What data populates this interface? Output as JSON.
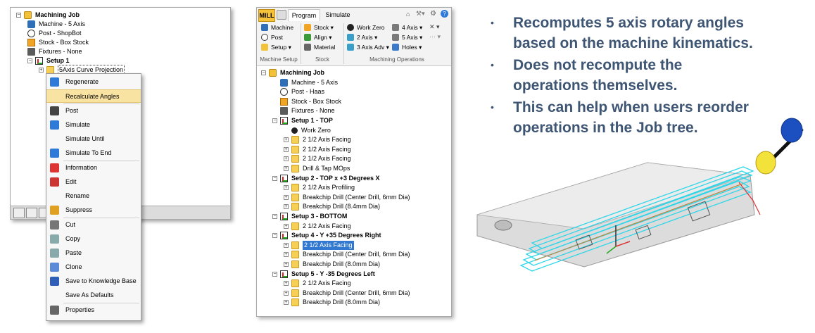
{
  "left_tree": {
    "items": [
      {
        "label": "Machining Job",
        "icon": "job-icon"
      },
      {
        "label": "Machine - 5 Axis",
        "icon": "machine-icon"
      },
      {
        "label": "Post - ShopBot",
        "icon": "post-icon"
      },
      {
        "label": "Stock - Box Stock",
        "icon": "stock-icon"
      },
      {
        "label": "Fixtures - None",
        "icon": "fixture-icon"
      },
      {
        "label": "Setup 1",
        "icon": "setup-icon"
      },
      {
        "label": "5Axis Curve Projection",
        "icon": "folder-icon"
      }
    ]
  },
  "context_menu": {
    "items": [
      {
        "label": "Regenerate",
        "icon": "regenerate-icon"
      },
      {
        "label": "Recalculate Angles",
        "icon": "none",
        "highlighted": true
      },
      {
        "label": "Post",
        "icon": "post-icon"
      },
      {
        "label": "Simulate",
        "icon": "play-icon"
      },
      {
        "label": "Simulate Until",
        "icon": "none"
      },
      {
        "label": "Simulate To End",
        "icon": "fast-forward-icon"
      },
      {
        "label": "Information",
        "icon": "info-icon"
      },
      {
        "label": "Edit",
        "icon": "edit-icon"
      },
      {
        "label": "Rename",
        "icon": "none"
      },
      {
        "label": "Suppress",
        "icon": "suppress-icon"
      },
      {
        "label": "Cut",
        "icon": "scissors-icon"
      },
      {
        "label": "Copy",
        "icon": "copy-icon"
      },
      {
        "label": "Paste",
        "icon": "paste-icon"
      },
      {
        "label": "Clone",
        "icon": "clone-icon"
      },
      {
        "label": "Save to Knowledge Base",
        "icon": "knowledge-base-icon"
      },
      {
        "label": "Save As Defaults",
        "icon": "none"
      },
      {
        "label": "Properties",
        "icon": "properties-icon"
      }
    ]
  },
  "ribbon": {
    "tabs": [
      "MILL",
      "Program",
      "Simulate"
    ],
    "active_tab": "Program",
    "buttons": {
      "machine": "Machine",
      "post": "Post",
      "setup": "Setup",
      "stock": "Stock",
      "align": "Align",
      "material": "Material",
      "work_zero": "Work Zero",
      "two_axis": "2 Axis",
      "three_axis_adv": "3 Axis Adv",
      "four_axis": "4 Axis",
      "five_axis": "5 Axis",
      "holes": "Holes"
    },
    "groups": [
      "Machine Setup",
      "Stock",
      "Machining Operations"
    ]
  },
  "job_tree": {
    "items": [
      {
        "label": "Machining Job",
        "bold": true,
        "level": 0,
        "icon": "job-icon"
      },
      {
        "label": "Machine - 5 Axis",
        "level": 1,
        "icon": "machine-icon"
      },
      {
        "label": "Post - Haas",
        "level": 1,
        "icon": "post-icon"
      },
      {
        "label": "Stock - Box Stock",
        "level": 1,
        "icon": "stock-icon"
      },
      {
        "label": "Fixtures - None",
        "level": 1,
        "icon": "fixture-icon"
      },
      {
        "label": "Setup 1 - TOP",
        "bold": true,
        "level": 1,
        "icon": "setup-icon"
      },
      {
        "label": "Work Zero",
        "level": 2,
        "icon": "work-zero-icon"
      },
      {
        "label": "2 1/2 Axis Facing",
        "level": 2,
        "icon": "folder-icon"
      },
      {
        "label": "2 1/2 Axis Facing",
        "level": 2,
        "icon": "folder-icon"
      },
      {
        "label": "2 1/2 Axis Facing",
        "level": 2,
        "icon": "folder-icon"
      },
      {
        "label": "Drill & Tap MOps",
        "level": 2,
        "icon": "folder-icon"
      },
      {
        "label": "Setup 2 - TOP x +3 Degrees X",
        "bold": true,
        "level": 1,
        "icon": "setup-icon"
      },
      {
        "label": "2 1/2 Axis Profiling",
        "level": 2,
        "icon": "folder-icon"
      },
      {
        "label": "Breakchip Drill (Center Drill, 6mm Dia)",
        "level": 2,
        "icon": "folder-icon"
      },
      {
        "label": "Breakchip Drill (8.4mm Dia)",
        "level": 2,
        "icon": "folder-icon"
      },
      {
        "label": "Setup 3 - BOTTOM",
        "bold": true,
        "level": 1,
        "icon": "setup-icon"
      },
      {
        "label": "2 1/2 Axis Facing",
        "level": 2,
        "icon": "folder-icon"
      },
      {
        "label": "Setup 4 - Y +35 Degrees Right",
        "bold": true,
        "level": 1,
        "icon": "setup-icon"
      },
      {
        "label": "2 1/2 Axis Facing",
        "level": 2,
        "icon": "folder-icon",
        "selected": true
      },
      {
        "label": "Breakchip Drill (Center Drill, 6mm Dia)",
        "level": 2,
        "icon": "folder-icon"
      },
      {
        "label": "Breakchip Drill (8.0mm Dia)",
        "level": 2,
        "icon": "folder-icon"
      },
      {
        "label": "Setup 5 - Y -35 Degrees Left",
        "bold": true,
        "level": 1,
        "icon": "setup-icon"
      },
      {
        "label": "2 1/2 Axis Facing",
        "level": 2,
        "icon": "folder-icon"
      },
      {
        "label": "Breakchip Drill (Center Drill, 6mm Dia)",
        "level": 2,
        "icon": "folder-icon"
      },
      {
        "label": "Breakchip Drill (8.0mm Dia)",
        "level": 2,
        "icon": "folder-icon"
      }
    ]
  },
  "bullets": [
    {
      "lines": [
        "Recomputes 5 axis rotary angles",
        "based on the machine kinematics."
      ]
    },
    {
      "lines": [
        "Does not recompute the",
        "operations themselves."
      ]
    },
    {
      "lines": [
        "This can help when users reorder",
        "operations in the Job tree."
      ]
    }
  ],
  "colors": {
    "bullet_text": "#3e5674",
    "highlight": "#f9e3a3",
    "selection": "#3078d0"
  }
}
